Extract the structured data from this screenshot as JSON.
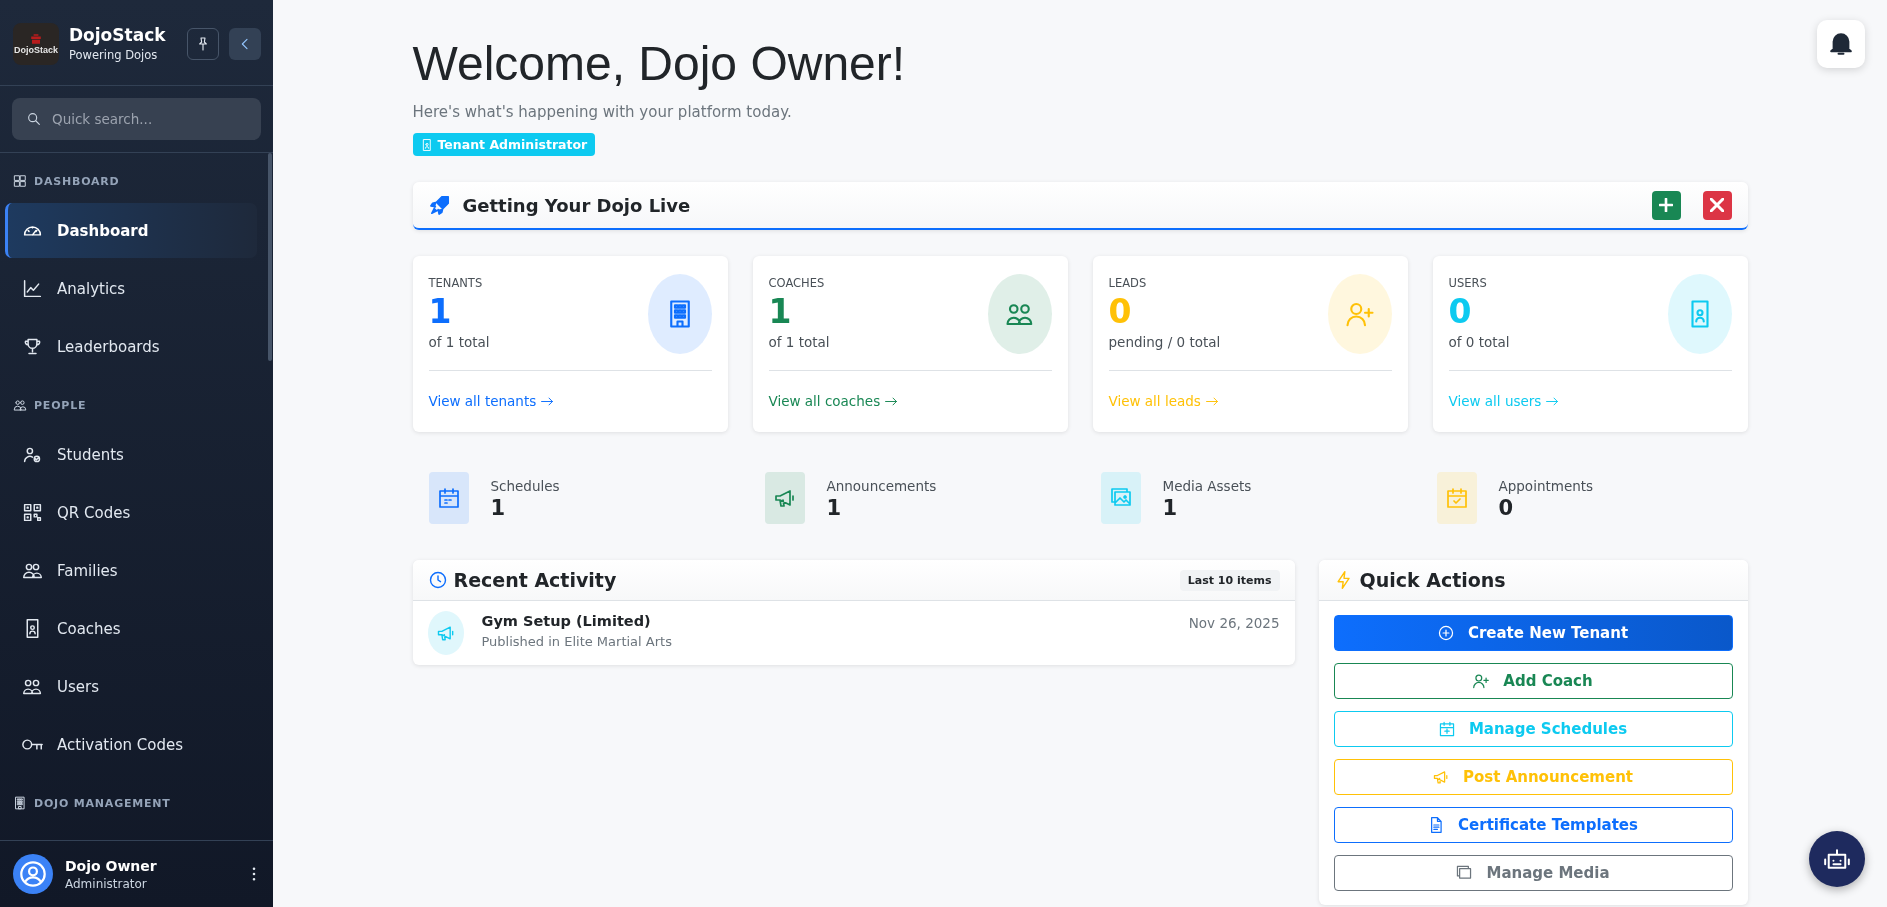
{
  "sidebar": {
    "brand": {
      "logo_text": "DojoStack",
      "name": "DojoStack",
      "tagline": "Powering Dojos"
    },
    "search": {
      "placeholder": "Quick search..."
    },
    "sections": [
      {
        "title": "DASHBOARD",
        "items": [
          {
            "label": "Dashboard",
            "selected": true
          },
          {
            "label": "Analytics",
            "selected": false
          },
          {
            "label": "Leaderboards",
            "selected": false
          }
        ]
      },
      {
        "title": "PEOPLE",
        "items": [
          {
            "label": "Students",
            "selected": false
          },
          {
            "label": "QR Codes",
            "selected": false
          },
          {
            "label": "Families",
            "selected": false
          },
          {
            "label": "Coaches",
            "selected": false
          },
          {
            "label": "Users",
            "selected": false
          },
          {
            "label": "Activation Codes",
            "selected": false
          }
        ]
      },
      {
        "title": "DOJO MANAGEMENT"
      }
    ],
    "user": {
      "name": "Dojo Owner",
      "role": "Administrator"
    }
  },
  "header": {
    "title": "Welcome, Dojo Owner!",
    "subtitle": "Here's what's happening with your platform today.",
    "role_badge": "Tenant Administrator"
  },
  "setup_panel": {
    "title": "Getting Your Dojo Live"
  },
  "stat_cards": [
    {
      "label": "TENANTS",
      "value": "1",
      "detail": "of 1 total",
      "link": "View all tenants",
      "color": "#0d6efd"
    },
    {
      "label": "COACHES",
      "value": "1",
      "detail": "of 1 total",
      "link": "View all coaches",
      "color": "#198754"
    },
    {
      "label": "LEADS",
      "value": "0",
      "detail": "pending / 0 total",
      "link": "View all leads",
      "color": "#ffc107"
    },
    {
      "label": "USERS",
      "value": "0",
      "detail": "of 0 total",
      "link": "View all users",
      "color": "#0dcaf0"
    }
  ],
  "mini_stats": [
    {
      "label": "Schedules",
      "value": "1",
      "color": "#0d6efd"
    },
    {
      "label": "Announcements",
      "value": "1",
      "color": "#198754"
    },
    {
      "label": "Media Assets",
      "value": "1",
      "color": "#0dcaf0"
    },
    {
      "label": "Appointments",
      "value": "0",
      "color": "#ffc107"
    }
  ],
  "recent_activity": {
    "title": "Recent Activity",
    "badge": "Last 10 items",
    "items": [
      {
        "title": "Gym Setup (Limited)",
        "subtitle": "Published in Elite Martial Arts",
        "date": "Nov 26, 2025"
      }
    ]
  },
  "quick_actions": {
    "title": "Quick Actions",
    "buttons": [
      {
        "label": "Create New Tenant",
        "kind": "solid",
        "color": "#0d6efd"
      },
      {
        "label": "Add Coach",
        "kind": "outline",
        "color": "#198754"
      },
      {
        "label": "Manage Schedules",
        "kind": "outline",
        "color": "#0dcaf0"
      },
      {
        "label": "Post Announcement",
        "kind": "outline",
        "color": "#ffc107"
      },
      {
        "label": "Certificate Templates",
        "kind": "outline",
        "color": "#0d6efd"
      },
      {
        "label": "Manage Media",
        "kind": "outline",
        "color": "#6c757d"
      }
    ]
  }
}
